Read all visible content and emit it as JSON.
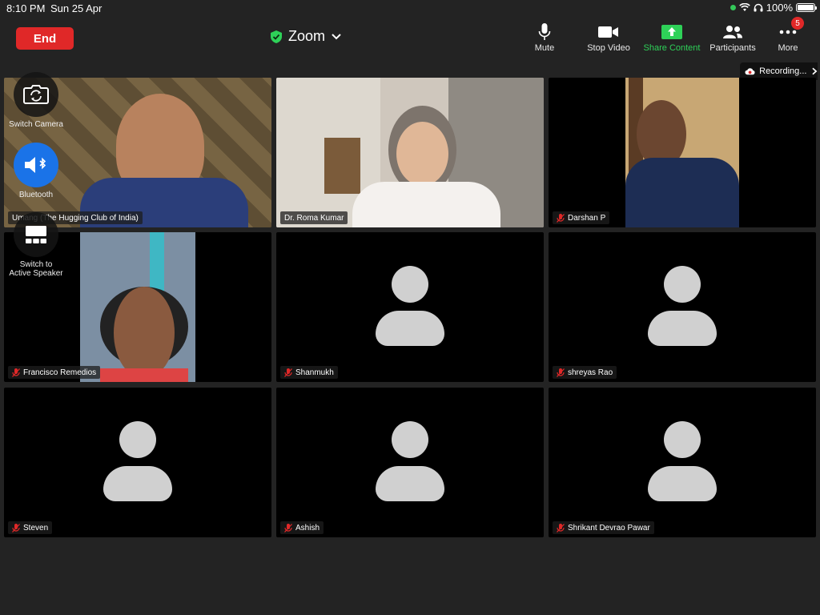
{
  "status": {
    "time": "8:10 PM",
    "date": "Sun 25 Apr",
    "battery": "100%"
  },
  "meeting": {
    "end_label": "End",
    "title": "Zoom"
  },
  "toolbar": {
    "mute": "Mute",
    "stop_video": "Stop Video",
    "share": "Share Content",
    "participants": "Participants",
    "more": "More",
    "more_badge": "5"
  },
  "recording": {
    "label": "Recording..."
  },
  "controls": {
    "switch_camera": "Switch Camera",
    "bluetooth": "Bluetooth",
    "switch_speaker_line1": "Switch to",
    "switch_speaker_line2": "Active Speaker"
  },
  "participants": [
    {
      "name": "Umang (The Hugging Club of India)",
      "muted": false,
      "video": true
    },
    {
      "name": "Dr. Roma Kumar",
      "muted": false,
      "video": true
    },
    {
      "name": "Darshan P",
      "muted": true,
      "video": true
    },
    {
      "name": "Francisco Remedios",
      "muted": true,
      "video": true
    },
    {
      "name": "Shanmukh",
      "muted": true,
      "video": false
    },
    {
      "name": "shreyas Rao",
      "muted": true,
      "video": false
    },
    {
      "name": "Steven",
      "muted": true,
      "video": false
    },
    {
      "name": "Ashish",
      "muted": true,
      "video": false
    },
    {
      "name": "Shrikant Devrao Pawar",
      "muted": true,
      "video": false
    }
  ],
  "colors": {
    "end": "#e02828",
    "share": "#2ed158",
    "shield": "#2ed158",
    "muted": "#e02828",
    "bluetooth_btn": "#1a73e8"
  }
}
